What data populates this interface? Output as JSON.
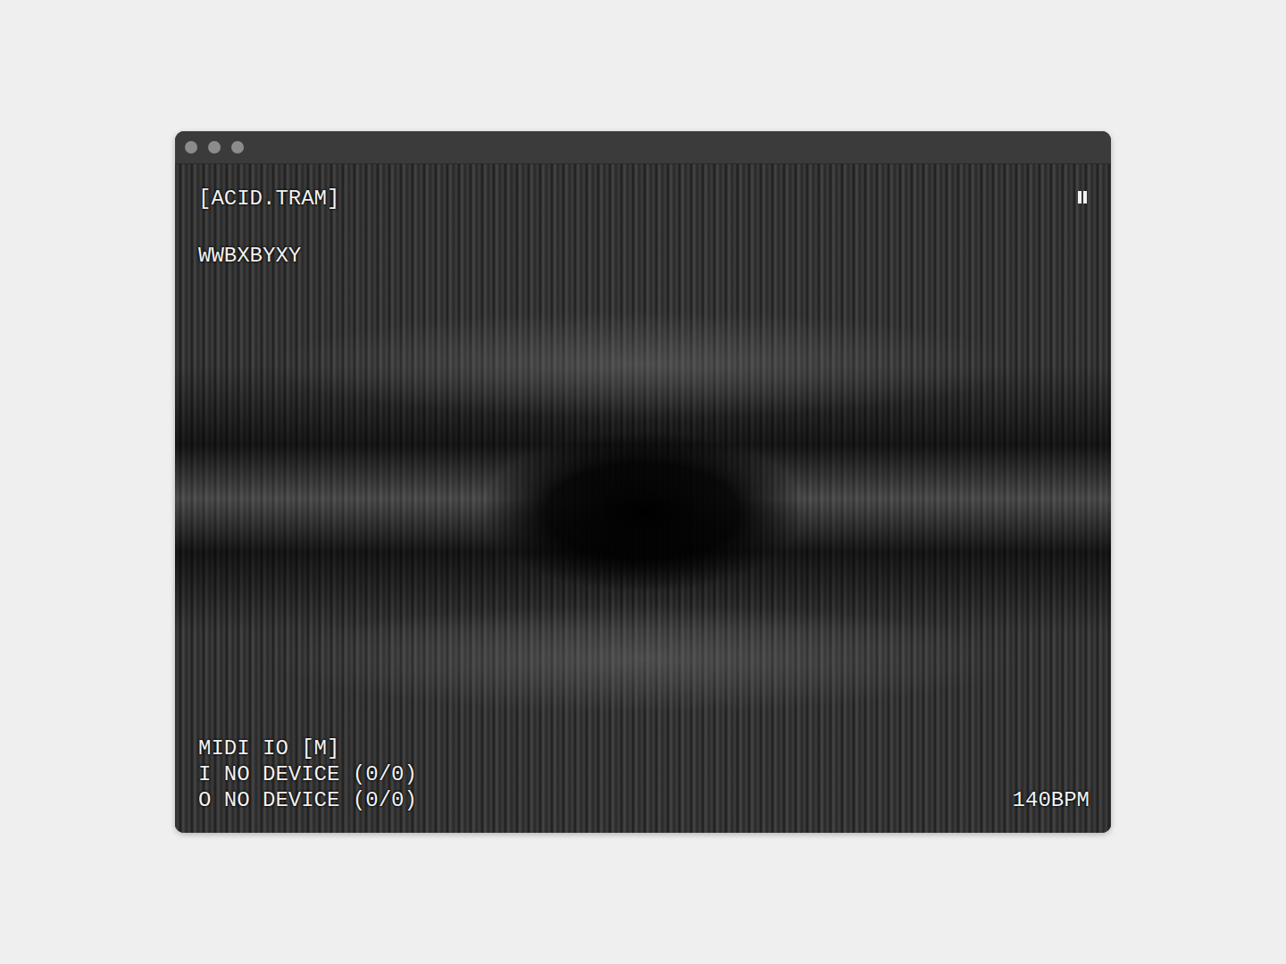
{
  "app": {
    "title": "[ACID.TRAM]",
    "pattern": "WWBXBYXY"
  },
  "transport": {
    "playing": true,
    "tempo": "140BPM"
  },
  "midi": {
    "heading": "MIDI IO [M]",
    "ports": [
      {
        "label": "I NO DEVICE (0/0)"
      },
      {
        "label": "O NO DEVICE (0/0)"
      }
    ]
  }
}
